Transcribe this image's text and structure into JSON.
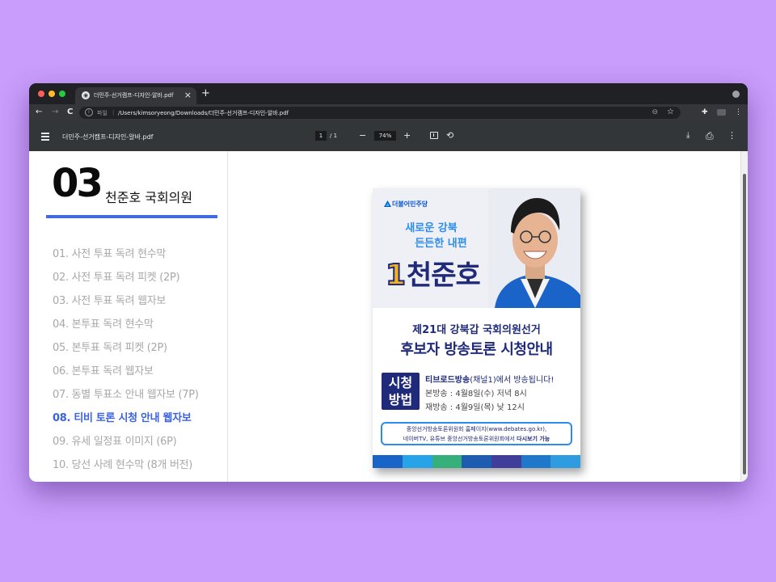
{
  "browser": {
    "tab_title": "더민주-선거캠프-디자인-알바.pdf",
    "tab_close": "×",
    "new_tab": "+",
    "nav_back": "←",
    "nav_forward": "→",
    "nav_reload": "C",
    "address_protocol": "파일",
    "address_separator": "|",
    "address_url": "/Users/kimsoryeong/Downloads/더민주-선거캠프-디자인-알바.pdf",
    "zoom_icon": "⊖",
    "bookmark_icon": "☆",
    "extensions_icon": "✚",
    "menu_icon": "⋮"
  },
  "pdf_toolbar": {
    "file_name": "더민주-선거캠프-디자인-알바.pdf",
    "current_page": "1",
    "page_total": "/  1",
    "zoom_out": "−",
    "zoom_value": "74%",
    "zoom_in": "+",
    "rotate_icon": "⟲",
    "download_icon": "⤓",
    "print_icon": "⎙",
    "more_icon": "⋮"
  },
  "document": {
    "section_number": "03",
    "section_title": "천준호 국회의원",
    "toc": [
      "01. 사전 투표 독려 현수막",
      "02. 사전 투표 독려 피켓 (2P)",
      "03. 사전 투표 독려 웹자보",
      "04. 본투표 독려 현수막",
      "05. 본투표 독려 피켓 (2P)",
      "06. 본투표 독려 웹자보",
      "07. 동별 투표소 안내 웹자보 (7P)",
      "08. 티비 토론 시청 안내 웹자보",
      "09. 유세 일정표 이미지 (6P)",
      "10. 당선 사례 현수막 (8개 버전)"
    ],
    "active_index": 7
  },
  "poster": {
    "party": "더불어민주당",
    "slogan_line1": "새로운 강북",
    "slogan_line2": "든든한 내편",
    "candidate_number": "1",
    "candidate_name": "천준호",
    "title_line1": "제21대 강북갑 국회의원선거",
    "title_line2": "후보자 방송토론 시청안내",
    "how_line1": "시청",
    "how_line2": "방법",
    "broadcast_channel": "티브로드방송",
    "broadcast_rest": "(채널1)에서 방송됩니다!",
    "main_broadcast": "본방송 : 4월8일(수) 저녁 8시",
    "rebroadcast": "재방송 : 4월9일(목) 낮 12시",
    "web_line1": "중앙선거방송토론위원회 홈페이지(www.debates.go.kr),",
    "web_line2_a": "네이버TV, 유튜브 중앙선거방송토론위원회에서 ",
    "web_line2_b": "다시보기 가능"
  },
  "colors": {
    "background": "#c89dfb",
    "accent_blue": "#3a61e6",
    "poster_navy": "#1f2a7a",
    "poster_sky": "#2b8cf0",
    "number_gold": "#f2b21f"
  }
}
